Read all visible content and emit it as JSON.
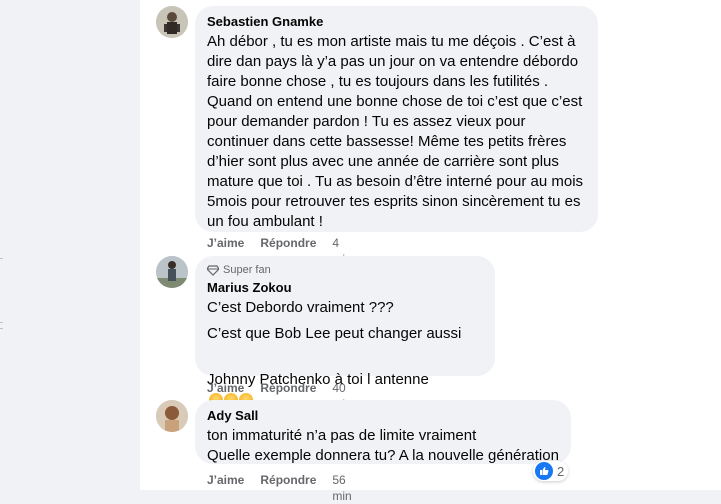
{
  "colors": {
    "bubble": "#f0f2f5",
    "meta_text": "#65676b",
    "like_blue": "#1877f2"
  },
  "comments": [
    {
      "author": "Sebastien Gnamke",
      "text": "Ah débor , tu es mon artiste mais tu me déçois . C’est à\ndire dan pays là y’a pas un jour on va entendre débordo\nfaire bonne chose , tu es toujours dans les futilités .\nQuand on entend une bonne chose de toi c’est que c’est\npour demander pardon ! Tu es assez vieux pour\ncontinuer dans cette bassesse! Même tes petits frères\nd’hier sont plus avec une année de carrière sont plus\nmature que toi . Tu as besoin d’être interné pour au mois\n5mois pour retrouver tes esprits sinon sincèrement tu es\nun fou ambulant !",
      "like": "J’aime",
      "reply": "Répondre",
      "time": "4 min"
    },
    {
      "badge": "Super fan",
      "badge_icon": "diamond-icon",
      "author": "Marius Zokou",
      "lines": [
        "C’est Debordo vraiment ???",
        "C’est que Bob Lee peut changer aussi",
        "Johnny Patchenko à toi l antenne"
      ],
      "emoji": "laughing-emoji",
      "like": "J’aime",
      "reply": "Répondre",
      "time": "40 min"
    },
    {
      "author": "Ady Sall",
      "text": "ton immaturité n’a pas de limite vraiment\nQuelle exemple donnera tu? A la nouvelle génération",
      "reaction_count": "2",
      "reaction_icon": "like-icon",
      "like": "J’aime",
      "reply": "Répondre",
      "time": "56 min"
    }
  ]
}
